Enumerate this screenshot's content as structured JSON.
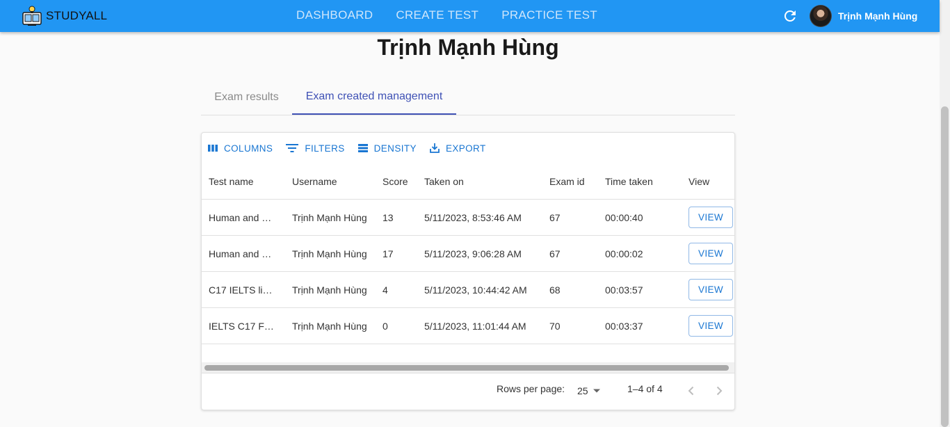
{
  "app": {
    "brand": "STUDYALL",
    "nav": [
      "DASHBOARD",
      "CREATE TEST",
      "PRACTICE TEST"
    ],
    "user_name": "Trịnh Mạnh Hùng",
    "accent": "#2196f3"
  },
  "profile": {
    "name": "Trịnh Mạnh Hùng"
  },
  "tabs": [
    {
      "label": "Exam results",
      "active": false
    },
    {
      "label": "Exam created management",
      "active": true
    }
  ],
  "toolbar": {
    "columns": "COLUMNS",
    "filters": "FILTERS",
    "density": "DENSITY",
    "export": "EXPORT"
  },
  "table": {
    "headers": [
      "Test name",
      "Username",
      "Score",
      "Taken on",
      "Exam id",
      "Time taken",
      "View"
    ],
    "rows": [
      {
        "test_name": "Human and …",
        "username": "Trịnh Mạnh Hùng",
        "score": "13",
        "taken_on": "5/11/2023, 8:53:46 AM",
        "exam_id": "67",
        "time_taken": "00:00:40",
        "view": "VIEW"
      },
      {
        "test_name": "Human and …",
        "username": "Trịnh Mạnh Hùng",
        "score": "17",
        "taken_on": "5/11/2023, 9:06:28 AM",
        "exam_id": "67",
        "time_taken": "00:00:02",
        "view": "VIEW"
      },
      {
        "test_name": "C17 IELTS li…",
        "username": "Trịnh Mạnh Hùng",
        "score": "4",
        "taken_on": "5/11/2023, 10:44:42 AM",
        "exam_id": "68",
        "time_taken": "00:03:57",
        "view": "VIEW"
      },
      {
        "test_name": "IELTS C17 F…",
        "username": "Trịnh Mạnh Hùng",
        "score": "0",
        "taken_on": "5/11/2023, 11:01:44 AM",
        "exam_id": "70",
        "time_taken": "00:03:37",
        "view": "VIEW"
      }
    ]
  },
  "pagination": {
    "rows_label": "Rows per page:",
    "rows_value": "25",
    "range": "1–4 of 4"
  }
}
